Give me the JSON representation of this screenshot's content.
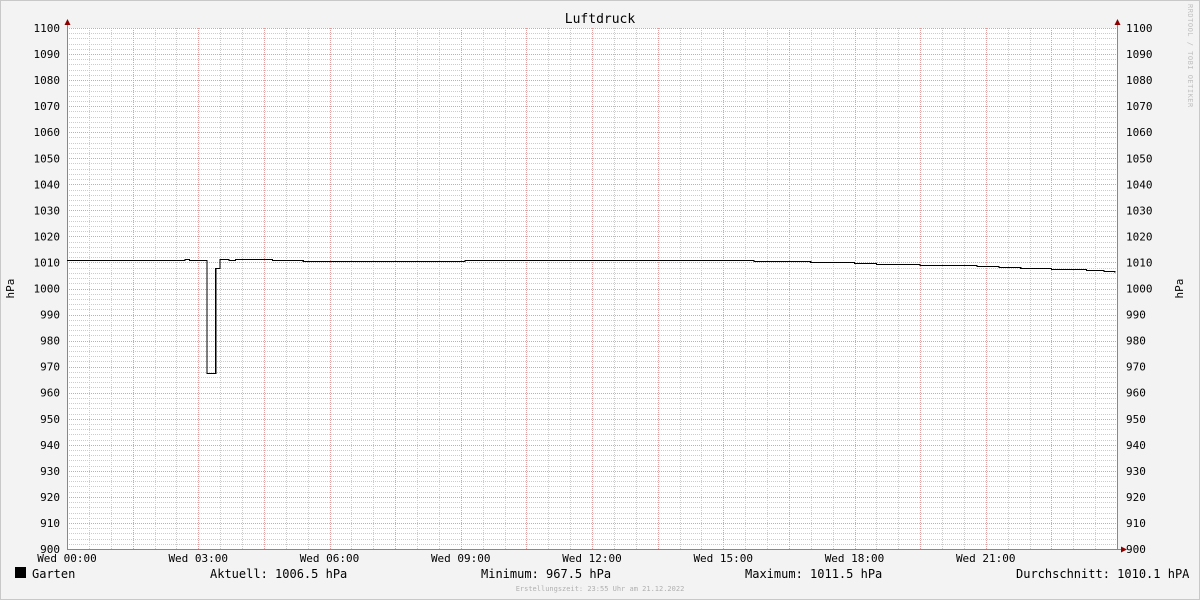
{
  "chart_data": {
    "type": "line",
    "title": "Luftdruck",
    "ylabel": "hPa",
    "ylabel_right": "hPa",
    "ylim": [
      900,
      1100
    ],
    "y_ticks": [
      900,
      910,
      920,
      930,
      940,
      950,
      960,
      970,
      980,
      990,
      1000,
      1010,
      1020,
      1030,
      1040,
      1050,
      1060,
      1070,
      1080,
      1090,
      1100
    ],
    "xlim": [
      0,
      24
    ],
    "x_ticks": [
      {
        "x": 0,
        "label": "Wed 00:00"
      },
      {
        "x": 3,
        "label": "Wed 03:00"
      },
      {
        "x": 6,
        "label": "Wed 06:00"
      },
      {
        "x": 9,
        "label": "Wed 09:00"
      },
      {
        "x": 12,
        "label": "Wed 12:00"
      },
      {
        "x": 15,
        "label": "Wed 15:00"
      },
      {
        "x": 18,
        "label": "Wed 18:00"
      },
      {
        "x": 21,
        "label": "Wed 21:00"
      }
    ],
    "grid": true,
    "colors": {
      "line": "#000000",
      "major_grid": "#e2a0a0",
      "minor_grid": "#cccccc",
      "axis": "#888888",
      "arrow": "#8b0000"
    },
    "series": [
      {
        "name": "Garten",
        "points": [
          [
            0,
            1011.0
          ],
          [
            2.6,
            1011.0
          ],
          [
            2.7,
            1011.2
          ],
          [
            2.8,
            1011.0
          ],
          [
            3.2,
            1011.0
          ],
          [
            3.2,
            967.5
          ],
          [
            3.25,
            967.5
          ],
          [
            3.4,
            1008.0
          ],
          [
            3.45,
            1008.0
          ],
          [
            3.5,
            1011.5
          ],
          [
            3.6,
            1011.2
          ],
          [
            3.7,
            1011.0
          ],
          [
            3.85,
            1011.3
          ],
          [
            4.6,
            1011.2
          ],
          [
            4.7,
            1010.8
          ],
          [
            5.3,
            1010.8
          ],
          [
            5.4,
            1010.5
          ],
          [
            6.0,
            1010.5
          ],
          [
            9.0,
            1010.5
          ],
          [
            9.1,
            1010.8
          ],
          [
            10.5,
            1010.8
          ],
          [
            10.6,
            1011.0
          ],
          [
            10.8,
            1010.8
          ],
          [
            11.0,
            1011.0
          ],
          [
            12.0,
            1011.0
          ],
          [
            14.0,
            1011.0
          ],
          [
            14.1,
            1010.8
          ],
          [
            15.0,
            1010.8
          ],
          [
            15.6,
            1010.8
          ],
          [
            15.7,
            1010.5
          ],
          [
            16.5,
            1010.5
          ],
          [
            17.0,
            1010.3
          ],
          [
            17.2,
            1010.0
          ],
          [
            18.0,
            1009.8
          ],
          [
            18.5,
            1009.5
          ],
          [
            18.9,
            1009.3
          ],
          [
            19.0,
            1009.5
          ],
          [
            19.5,
            1009.2
          ],
          [
            20.2,
            1009.0
          ],
          [
            20.8,
            1008.7
          ],
          [
            21.3,
            1008.3
          ],
          [
            21.8,
            1007.8
          ],
          [
            22.5,
            1007.5
          ],
          [
            23.0,
            1007.3
          ],
          [
            23.3,
            1007.0
          ],
          [
            23.7,
            1006.6
          ],
          [
            23.95,
            1006.5
          ]
        ]
      }
    ],
    "legend": {
      "series_label": "Garten",
      "current": "Aktuell: 1006.5 hPa",
      "minimum": "Minimum: 967.5 hPa",
      "maximum": "Maximum: 1011.5 hPa",
      "average": "Durchschnitt: 1010.1 hPA"
    },
    "footer": "Erstellungszeit: 23:55 Uhr am 21.12.2022",
    "credit": "RRDTOOL / TOBI OETIKER"
  }
}
